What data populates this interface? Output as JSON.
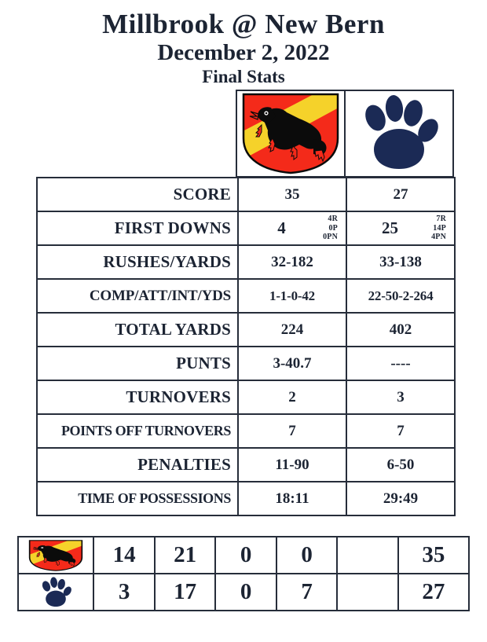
{
  "header": {
    "matchup": "Millbrook @ New Bern",
    "date": "December 2, 2022",
    "subtitle": "Final Stats"
  },
  "teams": [
    {
      "name": "Millbrook",
      "logo": "bear-shield-logo"
    },
    {
      "name": "New Bern",
      "logo": "paw-print-logo"
    }
  ],
  "colors": {
    "shield_red": "#F42A1A",
    "shield_yellow": "#F5D22A",
    "bear_black": "#0B0B0B",
    "paw_navy": "#1B2A55",
    "border": "#262D3A",
    "text": "#1C2433"
  },
  "stats": [
    {
      "label": "SCORE",
      "away": "35",
      "home": "27"
    },
    {
      "label": "FIRST DOWNS",
      "away": "4",
      "home": "25",
      "away_breakdown": [
        "4R",
        "0P",
        "0PN"
      ],
      "home_breakdown": [
        "7R",
        "14P",
        "4PN"
      ]
    },
    {
      "label": "RUSHES/YARDS",
      "away": "32-182",
      "home": "33-138"
    },
    {
      "label": "COMP/ATT/INT/YDS",
      "away": "1-1-0-42",
      "home": "22-50-2-264"
    },
    {
      "label": "TOTAL YARDS",
      "away": "224",
      "home": "402"
    },
    {
      "label": "PUNTS",
      "away": "3-40.7",
      "home": "----"
    },
    {
      "label": "TURNOVERS",
      "away": "2",
      "home": "3"
    },
    {
      "label": "POINTS OFF TURNOVERS",
      "away": "7",
      "home": "7"
    },
    {
      "label": "PENALTIES",
      "away": "11-90",
      "home": "6-50"
    },
    {
      "label": "TIME OF POSSESSIONS",
      "away": "18:11",
      "home": "29:49"
    }
  ],
  "linescore": {
    "rows": [
      {
        "team": "Millbrook",
        "logo": "bear-shield-logo",
        "q1": "14",
        "q2": "21",
        "q3": "0",
        "q4": "0",
        "ot": "",
        "total": "35"
      },
      {
        "team": "New Bern",
        "logo": "paw-print-logo",
        "q1": "3",
        "q2": "17",
        "q3": "0",
        "q4": "7",
        "ot": "",
        "total": "27"
      }
    ]
  }
}
